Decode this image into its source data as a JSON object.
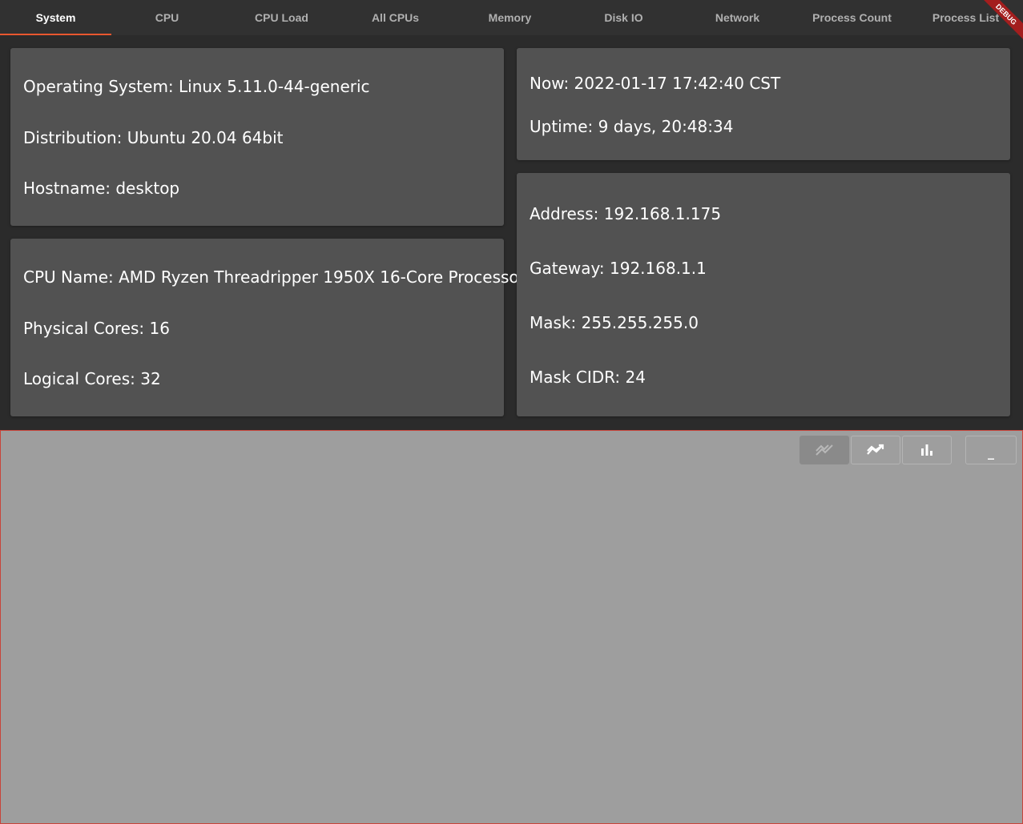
{
  "tabs": [
    {
      "label": "System",
      "active": true
    },
    {
      "label": "CPU"
    },
    {
      "label": "CPU Load"
    },
    {
      "label": "All CPUs"
    },
    {
      "label": "Memory"
    },
    {
      "label": "Disk IO"
    },
    {
      "label": "Network"
    },
    {
      "label": "Process Count"
    },
    {
      "label": "Process List"
    }
  ],
  "debug_banner": "DEBUG",
  "os_card": {
    "os": "Operating System: Linux 5.11.0-44-generic",
    "distribution": "Distribution: Ubuntu 20.04 64bit",
    "hostname": "Hostname: desktop"
  },
  "cpu_card": {
    "name": "CPU Name: AMD Ryzen Threadripper 1950X 16-Core Processo",
    "physical_cores": "Physical Cores: 16",
    "logical_cores": "Logical Cores: 32"
  },
  "time_card": {
    "now": "Now: 2022-01-17 17:42:40 CST",
    "uptime": "Uptime: 9 days, 20:48:34"
  },
  "network_card": {
    "address": "Address: 192.168.1.175",
    "gateway": "Gateway: 192.168.1.1",
    "mask": "Mask: 255.255.255.0",
    "mask_cidr": "Mask CIDR: 24"
  },
  "chart_toolbar": {
    "minimize_label": "_",
    "buttons": [
      {
        "icon": "line-chart-icon",
        "active": true
      },
      {
        "icon": "trend-chart-icon"
      },
      {
        "icon": "bar-chart-icon"
      }
    ]
  },
  "colors": {
    "accent": "#e8572f",
    "background": "#2b2b2b",
    "card": "#525252",
    "chart_panel": "#9e9e9e",
    "debug": "#a31e1e"
  }
}
